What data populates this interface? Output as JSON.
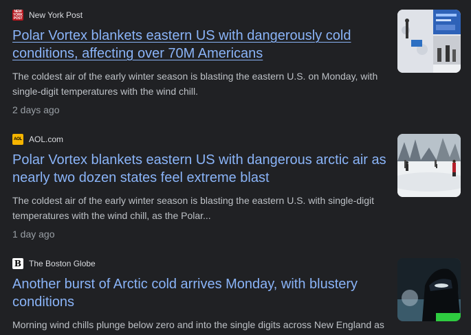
{
  "articles": [
    {
      "source": "New York Post",
      "favicon_text": "NEW YORK POST",
      "title": "Polar Vortex blankets eastern US with dangerously cold conditions, affecting over 70M Americans",
      "snippet": "The coldest air of the early winter season is blasting the eastern U.S. on Monday, with single-digit temperatures with the wind chill.",
      "time": "2 days ago",
      "thumbnail": "snow-shoveling-collage"
    },
    {
      "source": "AOL.com",
      "favicon_text": "AOL",
      "title": "Polar Vortex blankets eastern US with dangerous arctic air as nearly two dozen states feel extreme blast",
      "snippet": "The coldest air of the early winter season is blasting the eastern U.S. with single-digit temperatures with the wind chill, as the Polar...",
      "time": "1 day ago",
      "thumbnail": "snowy-park-walkers"
    },
    {
      "source": "The Boston Globe",
      "favicon_text": "B",
      "title": "Another burst of Arctic cold arrives Monday, with blustery conditions",
      "snippet": "Morning wind chills plunge below zero and into the single digits across New England as",
      "time": "",
      "thumbnail": "person-in-balaclava"
    }
  ],
  "colors": {
    "background": "#202124",
    "link": "#8ab4f8",
    "snippet": "#bdc1c6",
    "meta": "#9aa0a6"
  }
}
